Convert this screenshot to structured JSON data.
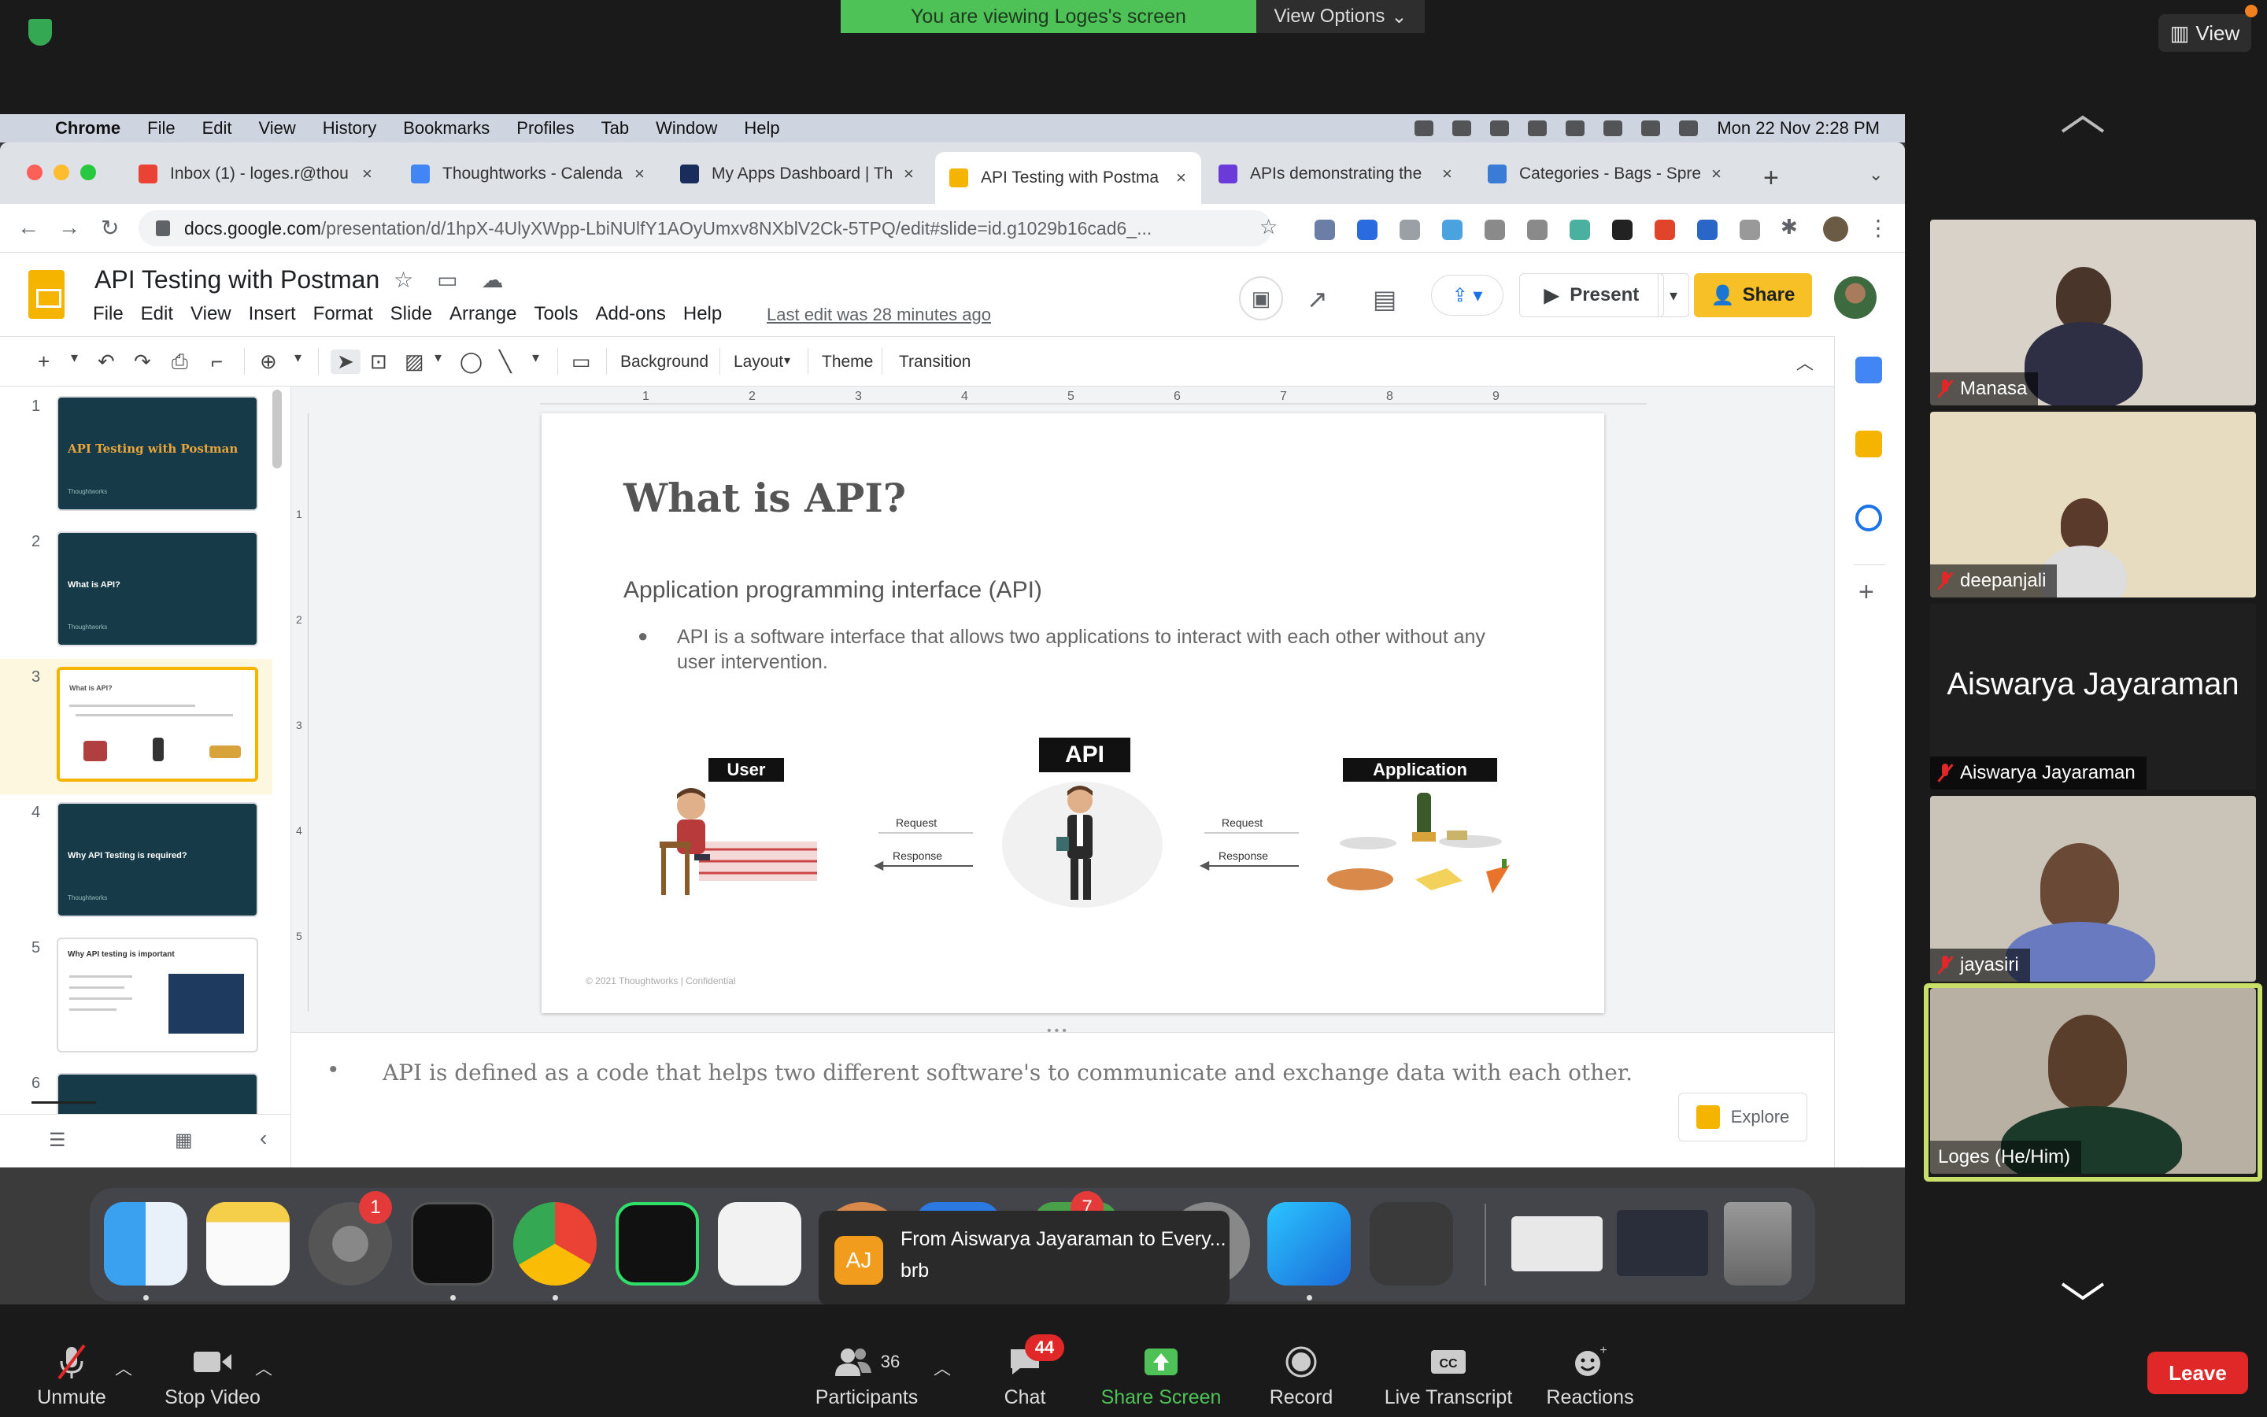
{
  "zoom": {
    "banner": "You are viewing Loges's screen",
    "view_options": "View Options",
    "view_button": "View",
    "bottom_bar": {
      "unmute": "Unmute",
      "stop_video": "Stop Video",
      "participants": "Participants",
      "participants_count": "36",
      "chat": "Chat",
      "chat_badge": "44",
      "share_screen": "Share Screen",
      "record": "Record",
      "live_transcript": "Live Transcript",
      "reactions": "Reactions",
      "leave": "Leave"
    },
    "participants": [
      {
        "name": "Manasa"
      },
      {
        "name": "deepanjali"
      },
      {
        "name": "Aiswarya Jayaraman",
        "display": "Aiswarya Jayaraman"
      },
      {
        "name": "jayasiri"
      },
      {
        "name": "Loges  (He/Him)"
      }
    ],
    "chat_toast": {
      "avatar": "AJ",
      "title": "From Aiswarya Jayaraman to Every...",
      "message": "brb"
    }
  },
  "mac_menu": {
    "app": "Chrome",
    "items": [
      "File",
      "Edit",
      "View",
      "History",
      "Bookmarks",
      "Profiles",
      "Tab",
      "Window",
      "Help"
    ],
    "clock": "Mon 22 Nov  2:28 PM"
  },
  "browser": {
    "tabs": [
      {
        "label": "Inbox (1) - loges.r@thou",
        "color": "#ea4335"
      },
      {
        "label": "Thoughtworks - Calenda",
        "color": "#4285f4"
      },
      {
        "label": "My Apps Dashboard | Th",
        "color": "#1a2c5b"
      },
      {
        "label": "API Testing with Postma",
        "color": "#f4b400"
      },
      {
        "label": "APIs demonstrating the",
        "color": "#6a3bd8"
      },
      {
        "label": "Categories - Bags - Spre",
        "color": "#3a7bd5"
      }
    ],
    "url_host": "docs.google.com",
    "url_path": "/presentation/d/1hpX-4UlyXWpp-LbiNUlfY1AOyUmxv8NXblV2Ck-5TPQ/edit#slide=id.g1029b16cad6_..."
  },
  "docs": {
    "title": "API Testing with Postman",
    "menu": [
      "File",
      "Edit",
      "View",
      "Insert",
      "Format",
      "Slide",
      "Arrange",
      "Tools",
      "Add-ons",
      "Help"
    ],
    "last_edit": "Last edit was 28 minutes ago",
    "present": "Present",
    "share": "Share",
    "toolbar": {
      "background": "Background",
      "layout": "Layout",
      "theme": "Theme",
      "transition": "Transition"
    },
    "ruler": [
      "1",
      "2",
      "3",
      "4",
      "5",
      "6",
      "7",
      "8",
      "9"
    ],
    "ruler_v": [
      "1",
      "2",
      "3",
      "4",
      "5"
    ],
    "thumbnails": [
      {
        "num": "1",
        "title": "API Testing with Postman",
        "sub": "Thoughtworks"
      },
      {
        "num": "2",
        "title": "What is API?",
        "sub": "Thoughtworks"
      },
      {
        "num": "3",
        "title": "What is API?"
      },
      {
        "num": "4",
        "title": "Why API Testing is required?",
        "sub": "Thoughtworks"
      },
      {
        "num": "5",
        "title": "Why API testing is important"
      },
      {
        "num": "6"
      }
    ],
    "slide": {
      "heading": "What is API?",
      "subheading": "Application programming interface (API)",
      "bullet": "API is a software interface that allows two applications to interact with each other without any user intervention.",
      "label_user": "User",
      "label_api": "API",
      "label_app": "Application",
      "request": "Request",
      "response": "Response",
      "footer": "© 2021 Thoughtworks  |  Confidential"
    },
    "notes": "API is defined as a code that helps two different software's to communicate and exchange data with each other.",
    "explore": "Explore"
  }
}
